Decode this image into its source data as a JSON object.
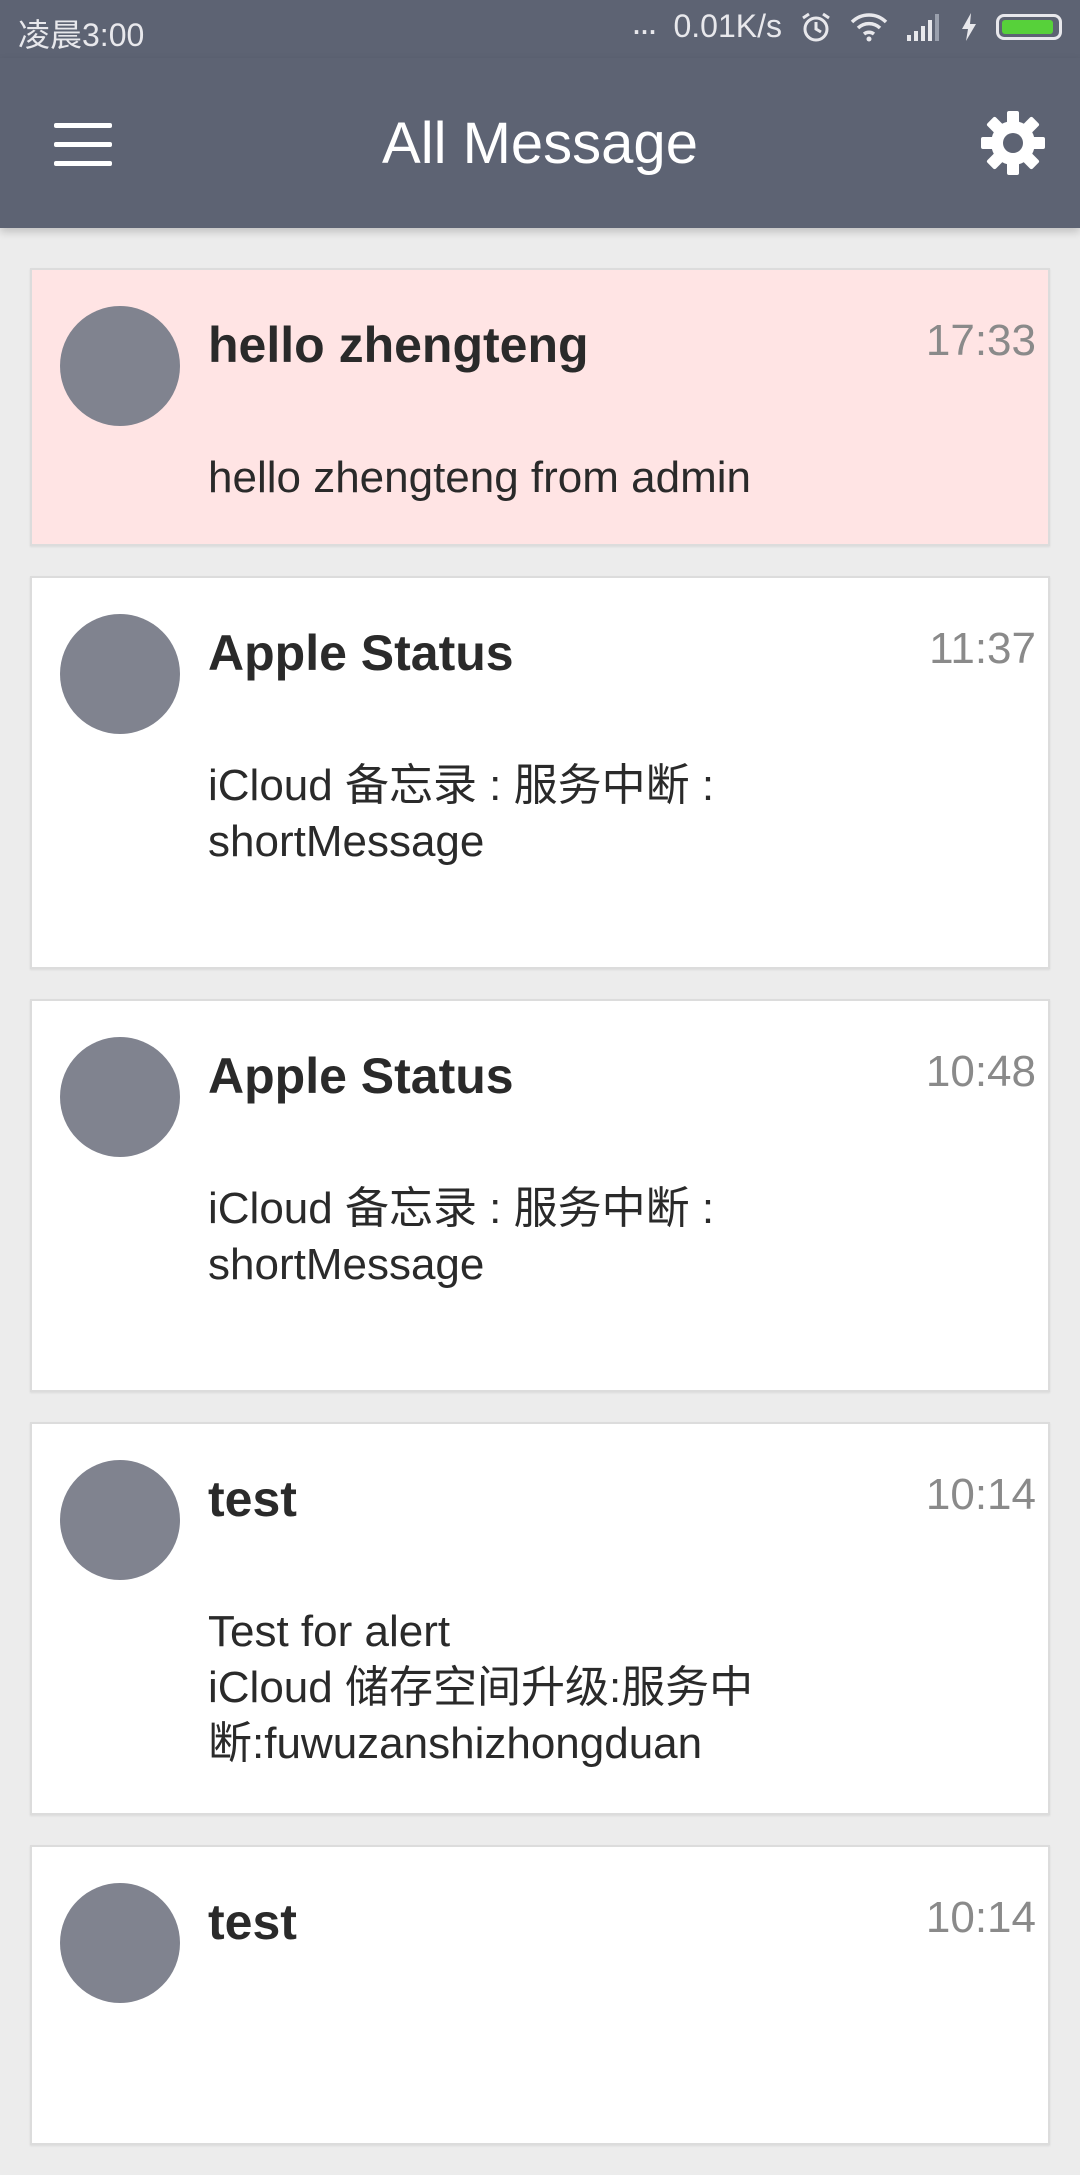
{
  "status_bar": {
    "time": "凌晨3:00",
    "dots": "...",
    "network_speed": "0.01K/s",
    "icons": [
      "alarm-icon",
      "wifi-icon",
      "signal-icon",
      "charging-icon",
      "battery-icon"
    ],
    "battery_level": 0.95,
    "battery_color": "#57d13a"
  },
  "app_bar": {
    "title": "All Message",
    "menu_icon": "hamburger-menu-icon",
    "settings_icon": "gear-icon",
    "background": "#5d6373"
  },
  "messages": [
    {
      "title": "hello zhengteng",
      "time": "17:33",
      "body": "hello zhengteng from admin",
      "highlighted": true
    },
    {
      "title": "Apple Status",
      "time": "11:37",
      "body": "iCloud 备忘录 : 服务中断 :\nshortMessage",
      "highlighted": false
    },
    {
      "title": "Apple Status",
      "time": "10:48",
      "body": "iCloud 备忘录 : 服务中断 :\nshortMessage",
      "highlighted": false
    },
    {
      "title": "test",
      "time": "10:14",
      "body": "Test for alert\niCloud 储存空间升级:服务中\n断:fuwuzanshizhongduan",
      "highlighted": false
    },
    {
      "title": "test",
      "time": "10:14",
      "body": "",
      "highlighted": false
    }
  ],
  "colors": {
    "highlight": "#ffe4e4",
    "avatar": "#80838f",
    "background": "#ececec"
  }
}
